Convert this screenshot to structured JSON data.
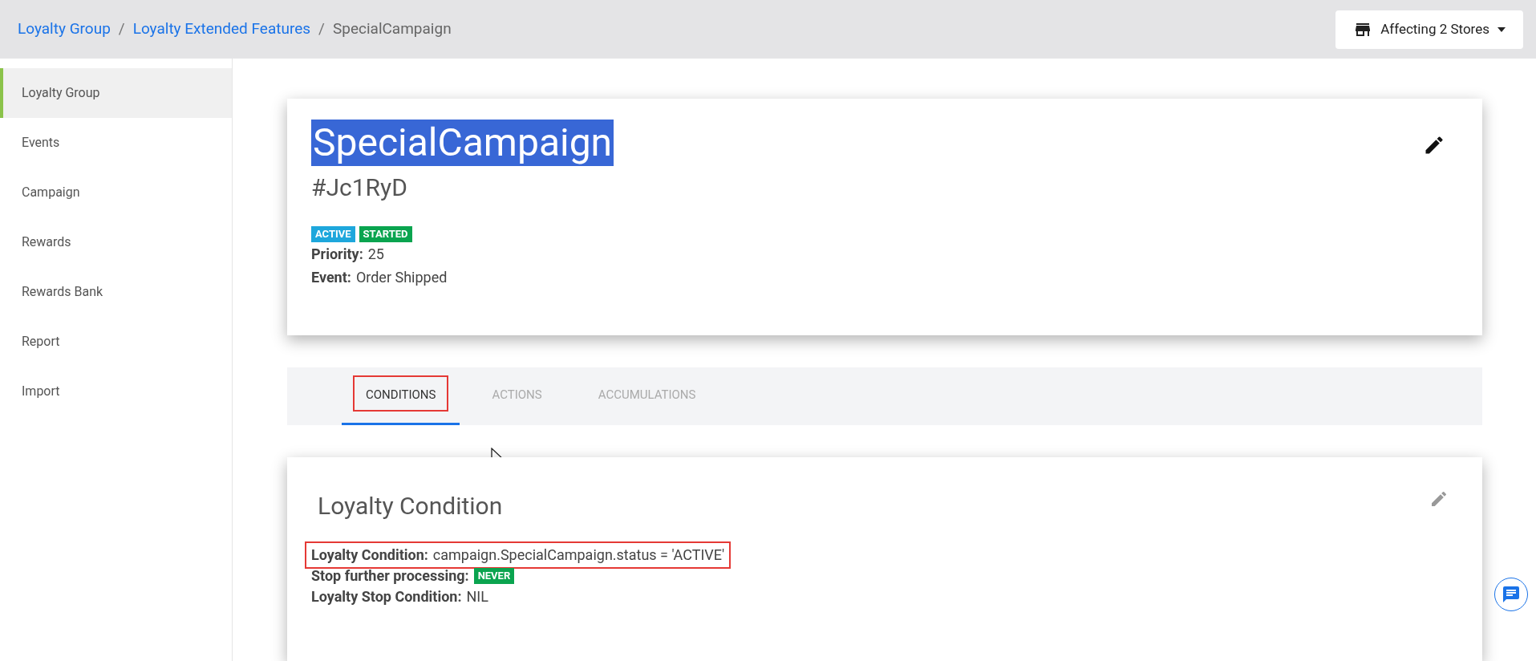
{
  "breadcrumb": [
    {
      "label": "Loyalty Group",
      "kind": "link"
    },
    {
      "label": "/",
      "kind": "separator"
    },
    {
      "label": "Loyalty Extended Features",
      "kind": "link"
    },
    {
      "label": "/",
      "kind": "separator"
    },
    {
      "label": "SpecialCampaign",
      "kind": "current"
    }
  ],
  "store_button": {
    "label": "Affecting 2 Stores"
  },
  "sidebar": {
    "items": [
      {
        "label": "Loyalty Group",
        "selected": true
      },
      {
        "label": "Events",
        "selected": false
      },
      {
        "label": "Campaign",
        "selected": false
      },
      {
        "label": "Rewards",
        "selected": false
      },
      {
        "label": "Rewards Bank",
        "selected": false
      },
      {
        "label": "Report",
        "selected": false
      },
      {
        "label": "Import",
        "selected": false
      }
    ]
  },
  "campaign": {
    "title": "SpecialCampaign",
    "title_selected": true,
    "code": "#Jc1RyD",
    "badges": [
      {
        "label": "ACTIVE",
        "color": "#1ea7dc"
      },
      {
        "label": "STARTED",
        "color": "#0aa44f"
      }
    ],
    "fields": [
      {
        "label": "Priority:",
        "value": "25"
      },
      {
        "label": "Event:",
        "value": "Order Shipped"
      }
    ]
  },
  "tabs": [
    {
      "label": "CONDITIONS",
      "selected": true,
      "highlighted": true
    },
    {
      "label": "ACTIONS",
      "selected": false,
      "highlighted": false
    },
    {
      "label": "ACCUMULATIONS",
      "selected": false,
      "highlighted": false
    }
  ],
  "condition_card": {
    "title": "Loyalty Condition",
    "rows": [
      {
        "kind": "text",
        "label": "Loyalty Condition:",
        "value": "campaign.SpecialCampaign.status = 'ACTIVE'",
        "highlighted": true
      },
      {
        "kind": "badge",
        "label": "Stop further processing:",
        "value": "NEVER",
        "color": "#0aa44f",
        "highlighted": false
      },
      {
        "kind": "text",
        "label": "Loyalty Stop Condition:",
        "value": "NIL",
        "highlighted": false
      }
    ]
  }
}
